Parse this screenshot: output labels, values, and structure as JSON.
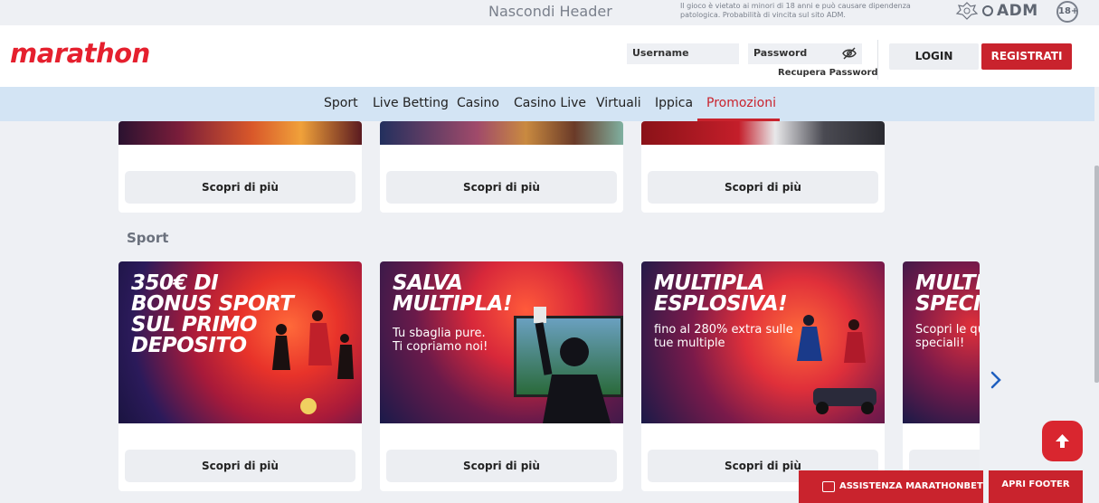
{
  "top": {
    "hide_header": "Nascondi Header",
    "disclaimer": "Il gioco è vietato ai minori di 18 anni e può causare dipendenza patologica. Probabilità di vincita sul sito ADM.",
    "adm": "ADM",
    "age": "18+"
  },
  "header": {
    "logo": "marathon",
    "username_placeholder": "Username",
    "password_placeholder": "Password",
    "recover": "Recupera Password",
    "login": "LOGIN",
    "register": "REGISTRATI"
  },
  "nav": {
    "items": [
      "Sport",
      "Live Betting",
      "Casino",
      "Casino Live",
      "Virtuali",
      "Ippica",
      "Promozioni"
    ],
    "active": "Promozioni"
  },
  "cta": "Scopri di più",
  "sections": {
    "sport_title": "Sport"
  },
  "promos": [
    {
      "title_lines": [
        "350€ DI",
        "BONUS SPORT",
        "SUL PRIMO",
        "DEPOSITO"
      ],
      "sub": ""
    },
    {
      "title_lines": [
        "SALVA",
        "MULTIPLA!"
      ],
      "sub_lines": [
        "Tu sbaglia pure.",
        "Ti copriamo noi!"
      ]
    },
    {
      "title_lines": [
        "MULTIPLA",
        "ESPLOSIVA!"
      ],
      "sub_lines": [
        "fino al 280% extra sulle",
        "tue multiple"
      ]
    },
    {
      "title_lines": [
        "MULTI",
        "SPECIA"
      ],
      "sub_lines": [
        "Scopri le quo",
        "speciali!"
      ]
    }
  ],
  "footer": {
    "assist": "ASSISTENZA MARATHONBET",
    "open_footer": "APRI FOOTER"
  },
  "colors": {
    "brand_red": "#c9232d",
    "nav_bg": "#d3e4f4",
    "page_bg": "#eef0f4"
  }
}
